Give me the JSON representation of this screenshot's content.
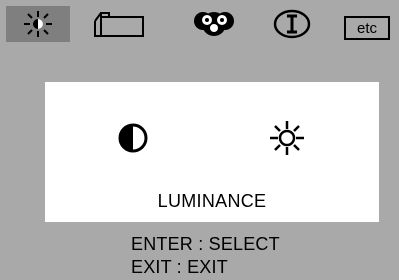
{
  "menu": {
    "tabs": [
      {
        "icon": "brightness-icon",
        "active": true
      },
      {
        "icon": "geometry-icon",
        "active": false
      },
      {
        "icon": "color-icon",
        "active": false
      },
      {
        "icon": "information-icon",
        "active": false
      },
      {
        "label": "etc",
        "active": false
      }
    ]
  },
  "panel": {
    "options": [
      {
        "icon": "contrast-icon"
      },
      {
        "icon": "brightness-sun-icon"
      }
    ],
    "label": "LUMINANCE"
  },
  "hints": {
    "enter": "ENTER : SELECT",
    "exit": "EXIT : EXIT"
  },
  "colors": {
    "background": "#a9a9a9",
    "active_tab": "#7f7f7f",
    "panel": "#ffffff"
  }
}
